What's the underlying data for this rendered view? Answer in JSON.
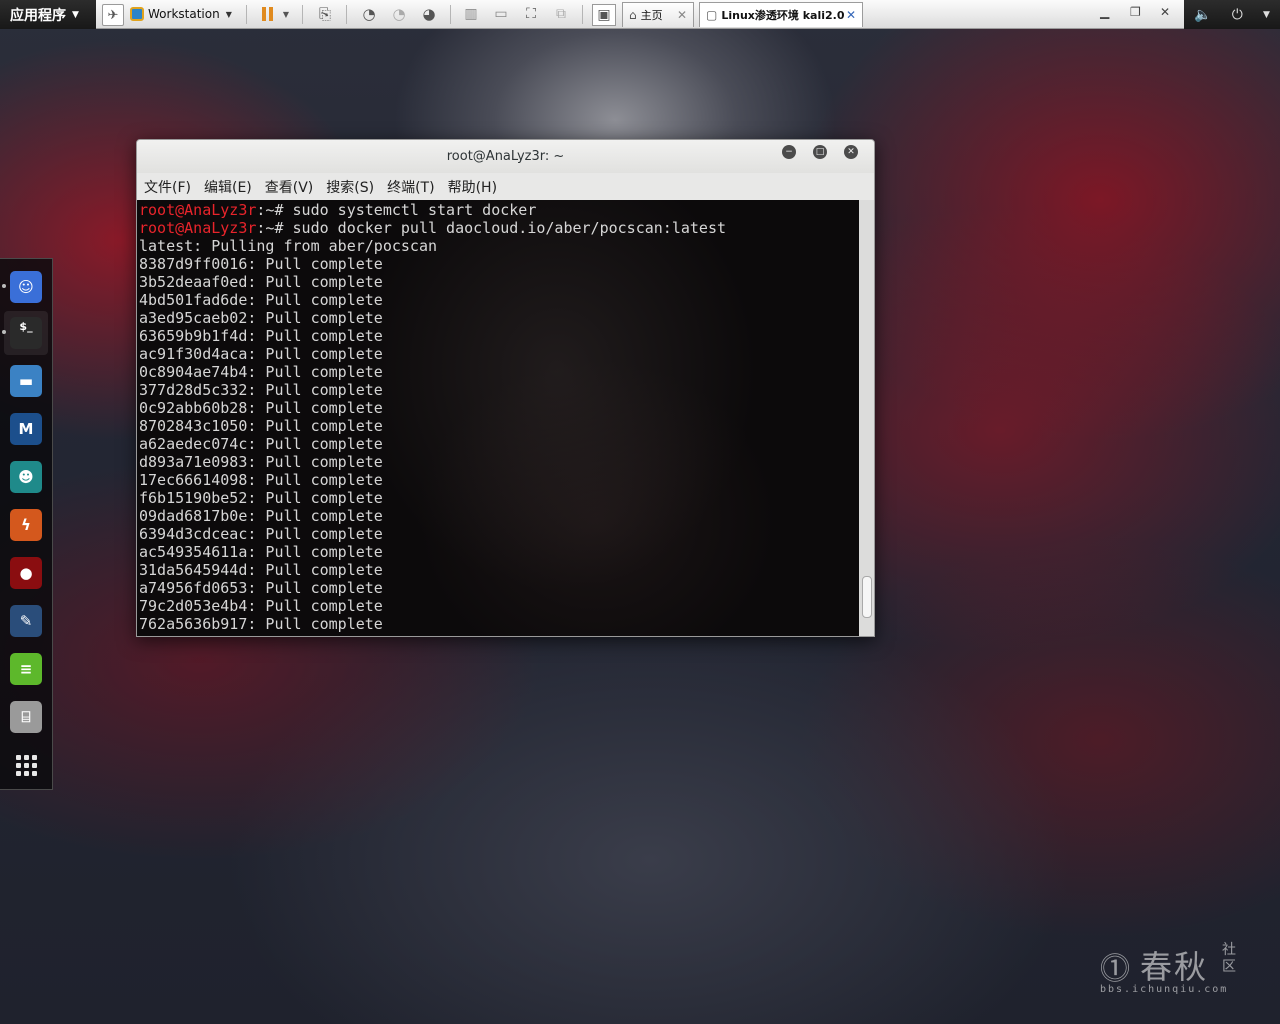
{
  "topbar": {
    "apps_menu_label": "应用程序",
    "vm_toolbar": {
      "workstation_label": "Workstation",
      "tabs": [
        {
          "label": "主页",
          "active": false
        },
        {
          "label": "Linux渗透环境 kali2.0",
          "active": true
        }
      ]
    },
    "tray": {
      "volume_icon": "speaker-icon",
      "power_icon": "power-icon"
    }
  },
  "dock": {
    "items": [
      {
        "name": "dock-item-armitage",
        "icon": "armitage-icon",
        "color": "#3a6fd8",
        "glyph": "☺"
      },
      {
        "name": "dock-item-terminal",
        "icon": "terminal-icon",
        "color": "#2a2a2a",
        "glyph": "$_"
      },
      {
        "name": "dock-item-files",
        "icon": "folder-icon",
        "color": "#3b82c4",
        "glyph": "▬"
      },
      {
        "name": "dock-item-metasploit",
        "icon": "metasploit-icon",
        "color": "#1c4f8c",
        "glyph": "M"
      },
      {
        "name": "dock-item-beef",
        "icon": "beef-icon",
        "color": "#1f8a8a",
        "glyph": "☻"
      },
      {
        "name": "dock-item-burpsuite",
        "icon": "burpsuite-icon",
        "color": "#d4581d",
        "glyph": "ϟ"
      },
      {
        "name": "dock-item-faraday",
        "icon": "faraday-icon",
        "color": "#8a0d10",
        "glyph": "●"
      },
      {
        "name": "dock-item-maltego",
        "icon": "maltego-icon",
        "color": "#2a4d7a",
        "glyph": "✎"
      },
      {
        "name": "dock-item-leafpad",
        "icon": "notes-icon",
        "color": "#5db82b",
        "glyph": "≡"
      },
      {
        "name": "dock-item-cutycapt",
        "icon": "camera-icon",
        "color": "#9a9a9a",
        "glyph": "⌸"
      },
      {
        "name": "dock-item-show-apps",
        "icon": "app-grid-icon",
        "color": "transparent",
        "glyph": ""
      }
    ]
  },
  "terminal": {
    "title": "root@AnaLyz3r: ~",
    "menu": [
      "文件(F)",
      "编辑(E)",
      "查看(V)",
      "搜索(S)",
      "终端(T)",
      "帮助(H)"
    ],
    "lines": [
      {
        "user": "root@AnaLyz3r",
        "rest": ":~# sudo systemctl start docker"
      },
      {
        "user": "root@AnaLyz3r",
        "rest": ":~# sudo docker pull daocloud.io/aber/pocscan:latest"
      },
      {
        "user": "",
        "rest": "latest: Pulling from aber/pocscan"
      },
      {
        "user": "",
        "rest": "8387d9ff0016: Pull complete"
      },
      {
        "user": "",
        "rest": "3b52deaaf0ed: Pull complete"
      },
      {
        "user": "",
        "rest": "4bd501fad6de: Pull complete"
      },
      {
        "user": "",
        "rest": "a3ed95caeb02: Pull complete"
      },
      {
        "user": "",
        "rest": "63659b9b1f4d: Pull complete"
      },
      {
        "user": "",
        "rest": "ac91f30d4aca: Pull complete"
      },
      {
        "user": "",
        "rest": "0c8904ae74b4: Pull complete"
      },
      {
        "user": "",
        "rest": "377d28d5c332: Pull complete"
      },
      {
        "user": "",
        "rest": "0c92abb60b28: Pull complete"
      },
      {
        "user": "",
        "rest": "8702843c1050: Pull complete"
      },
      {
        "user": "",
        "rest": "a62aedec074c: Pull complete"
      },
      {
        "user": "",
        "rest": "d893a71e0983: Pull complete"
      },
      {
        "user": "",
        "rest": "17ec66614098: Pull complete"
      },
      {
        "user": "",
        "rest": "f6b15190be52: Pull complete"
      },
      {
        "user": "",
        "rest": "09dad6817b0e: Pull complete"
      },
      {
        "user": "",
        "rest": "6394d3cdceac: Pull complete"
      },
      {
        "user": "",
        "rest": "ac549354611a: Pull complete"
      },
      {
        "user": "",
        "rest": "31da5645944d: Pull complete"
      },
      {
        "user": "",
        "rest": "a74956fd0653: Pull complete"
      },
      {
        "user": "",
        "rest": "79c2d053e4b4: Pull complete"
      },
      {
        "user": "",
        "rest": "762a5636b917: Pull complete"
      }
    ],
    "colors": {
      "prompt_user": "#e8242b",
      "text": "#d6d6d6",
      "background": "#0c0a0b"
    }
  },
  "watermark": {
    "brand": "春秋",
    "side_text": "社区",
    "url": "bbs.ichunqiu.com"
  }
}
